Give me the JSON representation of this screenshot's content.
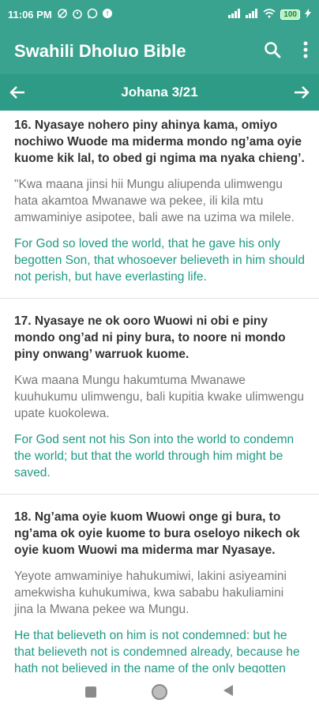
{
  "statusbar": {
    "time": "11:06 PM",
    "battery": "100"
  },
  "appbar": {
    "title": "Swahili Dholuo Bible"
  },
  "nav": {
    "chapter": "Johana 3/21"
  },
  "verses": [
    {
      "luo": "16. Nyasaye nohero piny ahinya kama, omiyo nochiwo Wuode ma miderma mondo ng’ama oyie kuome kik lal, to obed gi ngima ma nyaka chieng’.",
      "swahili": "\"Kwa maana jinsi hii Mungu aliupenda ulimwengu hata akamtoa Mwanawe wa pekee, ili kila mtu amwaminiye asipotee, bali awe na uzima wa milele.",
      "english": "For God so loved the world, that he gave his only begotten Son, that whosoever believeth in him should not perish, but have everlasting life."
    },
    {
      "luo": "17. Nyasaye ne ok ooro Wuowi ni obi e piny mondo ong’ad ni piny bura, to noore ni mondo piny onwang’ warruok kuome.",
      "swahili": "Kwa maana Mungu hakumtuma Mwanawe kuuhukumu ulimwengu, bali kupitia kwake ulimwengu upate kuokolewa.",
      "english": "For God sent not his Son into the world to condemn the world; but that the world through him might be saved."
    },
    {
      "luo": "18. Ng’ama oyie kuom Wuowi onge gi bura, to ng’ama ok oyie kuome to bura oseloyo nikech ok oyie kuom Wuowi ma miderma mar Nyasaye.",
      "swahili": "Yeyote amwaminiye hahukumiwi, lakini asiyeamini amekwisha kuhukumiwa, kwa sababu hakuliamini jina la Mwana pekee wa Mungu.",
      "english": "He that believeth on him is not condemned: but he that believeth not is condemned already, because he hath not believed in the name of the only begotten Son of God."
    }
  ],
  "icons": {
    "search": "search-icon",
    "menu": "more-vert-icon",
    "prev": "arrow-left-icon",
    "next": "arrow-right-icon"
  },
  "colors": {
    "primary": "#3aa38f",
    "english_text": "#1e9a86"
  }
}
